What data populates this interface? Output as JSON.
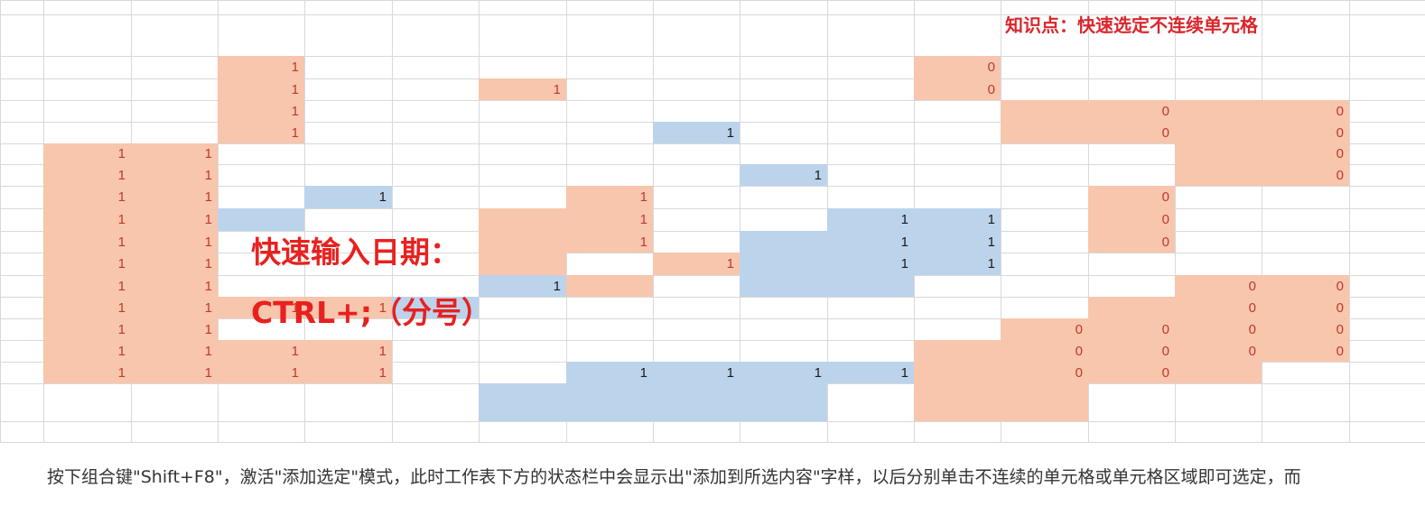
{
  "note": "知识点：快速选定不连续单元格",
  "overlay": {
    "line1": "快速输入日期：",
    "line2": "CTRL+;（分号）"
  },
  "caption": "按下组合键\"Shift+F8\"，激活\"添加选定\"模式，此时工作表下方的状态栏中会显示出\"添加到所选内容\"字样，以后分别单击不连续的单元格或单元格区域即可选定，而",
  "colors": {
    "orange": "#f7c6ad",
    "blue": "#bcd3ec",
    "red_text": "#d9262b",
    "overlay_red": "#e8211f"
  },
  "cells": [
    {
      "text": "1",
      "fill": "orange"
    },
    {
      "text": "1",
      "fill": "orange"
    },
    {
      "text": "1",
      "fill": "orange"
    },
    {
      "text": "1",
      "fill": "orange"
    },
    {
      "text": "0",
      "fill": "orange"
    },
    {
      "text": "0",
      "fill": "orange"
    },
    {
      "text": "1",
      "fill": "orange"
    },
    {
      "text": "1",
      "fill": "blue"
    },
    {
      "text": "0",
      "fill": "orange"
    },
    {
      "text": "0",
      "fill": "orange"
    },
    {
      "text": "0",
      "fill": "orange"
    },
    {
      "text": "0",
      "fill": "orange"
    },
    {
      "text": "0",
      "fill": "orange"
    },
    {
      "text": "0",
      "fill": "orange"
    },
    {
      "text": "1",
      "fill": "orange"
    },
    {
      "text": "1",
      "fill": "orange"
    },
    {
      "text": "1",
      "fill": "orange"
    },
    {
      "text": "1",
      "fill": "orange"
    },
    {
      "text": "1",
      "fill": "orange"
    },
    {
      "text": "1",
      "fill": "orange"
    },
    {
      "text": "1",
      "fill": "orange"
    },
    {
      "text": "1",
      "fill": "orange"
    },
    {
      "text": "1",
      "fill": "orange"
    },
    {
      "text": "1",
      "fill": "orange"
    },
    {
      "text": "1",
      "fill": "orange"
    },
    {
      "text": "1",
      "fill": "orange"
    },
    {
      "text": "1",
      "fill": "orange"
    },
    {
      "text": "1",
      "fill": "orange"
    },
    {
      "text": "1",
      "fill": "orange"
    },
    {
      "text": "1",
      "fill": "orange"
    },
    {
      "text": "1",
      "fill": "orange"
    },
    {
      "text": "1",
      "fill": "orange"
    },
    {
      "text": "1",
      "fill": "orange"
    },
    {
      "text": "1",
      "fill": "orange"
    },
    {
      "text": "1",
      "fill": "orange"
    },
    {
      "text": "1",
      "fill": "orange"
    },
    {
      "text": "1",
      "fill": "orange"
    },
    {
      "text": "1",
      "fill": "orange"
    },
    {
      "text": "1",
      "fill": "orange"
    },
    {
      "text": "1",
      "fill": "orange"
    },
    {
      "text": "1",
      "fill": "blue"
    },
    {
      "text": "1",
      "fill": "blue"
    },
    {
      "text": "1",
      "fill": "orange"
    },
    {
      "text": "1",
      "fill": "orange"
    },
    {
      "text": "1",
      "fill": "orange"
    },
    {
      "text": "1",
      "fill": "orange"
    },
    {
      "text": "1",
      "fill": "blue"
    },
    {
      "text": "1",
      "fill": "blue"
    },
    {
      "text": "1",
      "fill": "blue"
    },
    {
      "text": "1",
      "fill": "blue"
    },
    {
      "text": "1",
      "fill": "blue"
    },
    {
      "text": "1",
      "fill": "blue"
    },
    {
      "text": "0",
      "fill": "orange"
    },
    {
      "text": "0",
      "fill": "orange"
    },
    {
      "text": "0",
      "fill": "orange"
    },
    {
      "text": "1",
      "fill": "blue"
    },
    {
      "text": "0",
      "fill": "orange"
    },
    {
      "text": "0",
      "fill": "orange"
    },
    {
      "text": "0",
      "fill": "orange"
    },
    {
      "text": "0",
      "fill": "orange"
    },
    {
      "text": "1",
      "fill": "orange"
    },
    {
      "text": "1",
      "fill": "orange"
    },
    {
      "text": "0",
      "fill": "orange"
    },
    {
      "text": "0",
      "fill": "orange"
    },
    {
      "text": "0",
      "fill": "orange"
    },
    {
      "text": "0",
      "fill": "orange"
    },
    {
      "text": "0",
      "fill": "orange"
    },
    {
      "text": "0",
      "fill": "orange"
    },
    {
      "text": "0",
      "fill": "orange"
    },
    {
      "text": "0",
      "fill": "orange"
    },
    {
      "text": "1",
      "fill": "blue"
    },
    {
      "text": "1",
      "fill": "blue"
    },
    {
      "text": "1",
      "fill": "blue"
    },
    {
      "text": "1",
      "fill": "blue"
    },
    {
      "text": "0",
      "fill": "orange"
    },
    {
      "text": "0",
      "fill": "orange"
    }
  ]
}
